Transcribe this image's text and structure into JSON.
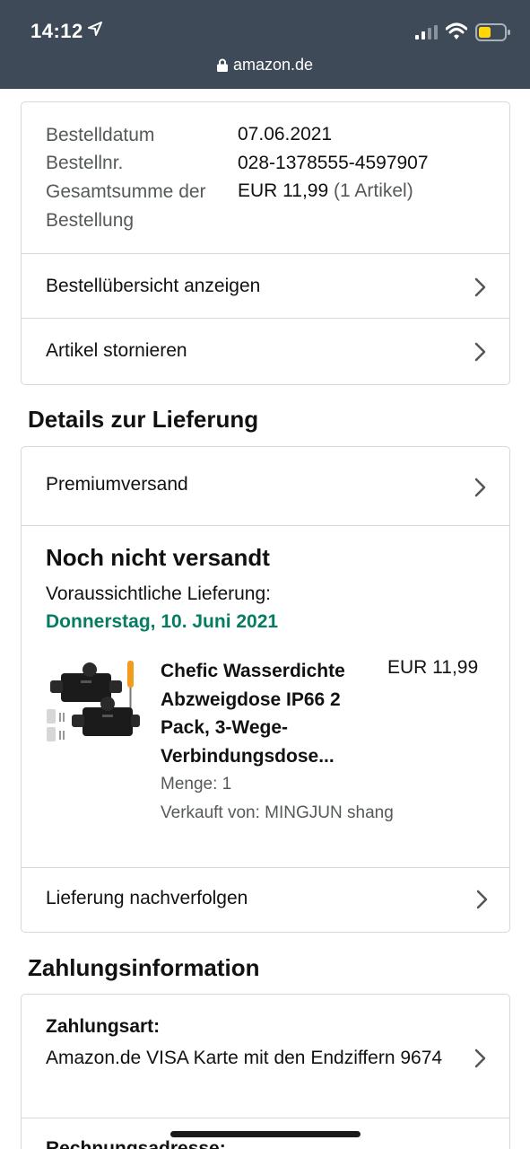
{
  "status_bar": {
    "time": "14:12",
    "url": "amazon.de"
  },
  "order_summary": {
    "rows": [
      {
        "label": "Bestelldatum",
        "value": "07.06.2021"
      },
      {
        "label": "Bestellnr.",
        "value": "028-1378555-4597907"
      },
      {
        "label": "Gesamtsumme der Bestellung",
        "value": "EUR 11,99",
        "value_extra": "(1 Artikel)"
      }
    ],
    "links": [
      {
        "label": "Bestellübersicht anzeigen"
      },
      {
        "label": "Artikel stornieren"
      }
    ]
  },
  "delivery": {
    "heading": "Details zur Lieferung",
    "shipping_method": "Premiumversand",
    "status": "Noch nicht versandt",
    "estimate_label": "Voraussichtliche Lieferung:",
    "estimate_date": "Donnerstag, 10. Juni 2021",
    "item": {
      "title": "Chefic Wasserdichte Abzweigdose IP66 2 Pack, 3-Wege-Verbindungsdose...",
      "price": "EUR 11,99",
      "quantity": "Menge: 1",
      "seller": "Verkauft von: MINGJUN shang"
    },
    "track_link": "Lieferung nachverfolgen"
  },
  "payment": {
    "heading": "Zahlungsinformation",
    "method_label": "Zahlungsart:",
    "method_text": "Amazon.de VISA Karte mit den Endziffern 9674",
    "billing_label": "Rechnungsadresse:"
  },
  "colors": {
    "topbar": "#3e4a58",
    "delivery_date": "#067d62",
    "battery": "#ffd60a",
    "border": "#d5d9d9"
  },
  "icons": [
    "location-arrow-icon",
    "signal-icon",
    "wifi-icon",
    "battery-icon",
    "lock-icon",
    "chevron-right-icon"
  ]
}
